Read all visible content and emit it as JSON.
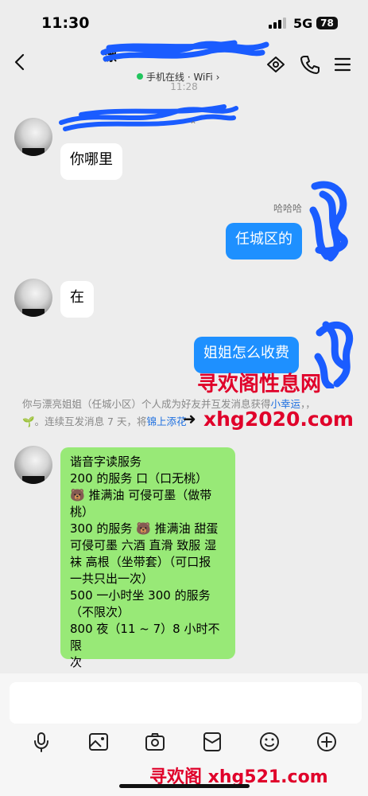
{
  "status_bar": {
    "time": "11:30",
    "network": "5G",
    "battery": "78"
  },
  "header": {
    "title": "漂",
    "online_status": "手机在线 · WiFi",
    "online_chevron": "›"
  },
  "timestamp": "11:28",
  "messages": [
    {
      "side": "in",
      "text": "你哪里"
    },
    {
      "side": "out",
      "reaction": "哈哈哈",
      "text": "任城区的"
    },
    {
      "side": "in",
      "text": "在"
    },
    {
      "side": "out",
      "text": "姐姐怎么收费"
    }
  ],
  "system_notice": {
    "line1": "你与漂亮姐姐（任城小区）个人成为好友并互发消息获得",
    "line1_link": "小幸运",
    "line1_tail": "，，",
    "line2_icon": "🌱",
    "line2": "。连续互发消息 7 天，将",
    "line2_link": "锦上添花"
  },
  "price_message": {
    "lines": [
      "谐音字读服务",
      "200 的服务  口（口无桃）",
      "🐻 推满油  可侵可墨（做带",
      "桃）",
      "300 的服务 🐻 推满油  甜蛋",
      "可侵可墨  六酒  直滑  致服  湿",
      "袜  高根（坐带套）（可口报",
      "一共只出一次）",
      "500 一小时坐 300 的服务",
      "（不限次）",
      "800 夜（11 ~ 7）8 小时不限",
      "次"
    ]
  },
  "watermarks": {
    "mid_line1": "寻欢阁性息网",
    "mid_line2": "xhg2020.com",
    "bottom": "寻欢阁 xhg521.com"
  },
  "input_bar": {
    "placeholder": "",
    "tools": [
      "microphone-icon",
      "image-icon",
      "camera-icon",
      "red-packet-icon",
      "emoji-icon",
      "plus-icon"
    ]
  },
  "colors": {
    "accent": "#1e90ff",
    "green_bubble": "#98e977",
    "watermark": "#e0002a",
    "scribble": "#1a5cff"
  }
}
